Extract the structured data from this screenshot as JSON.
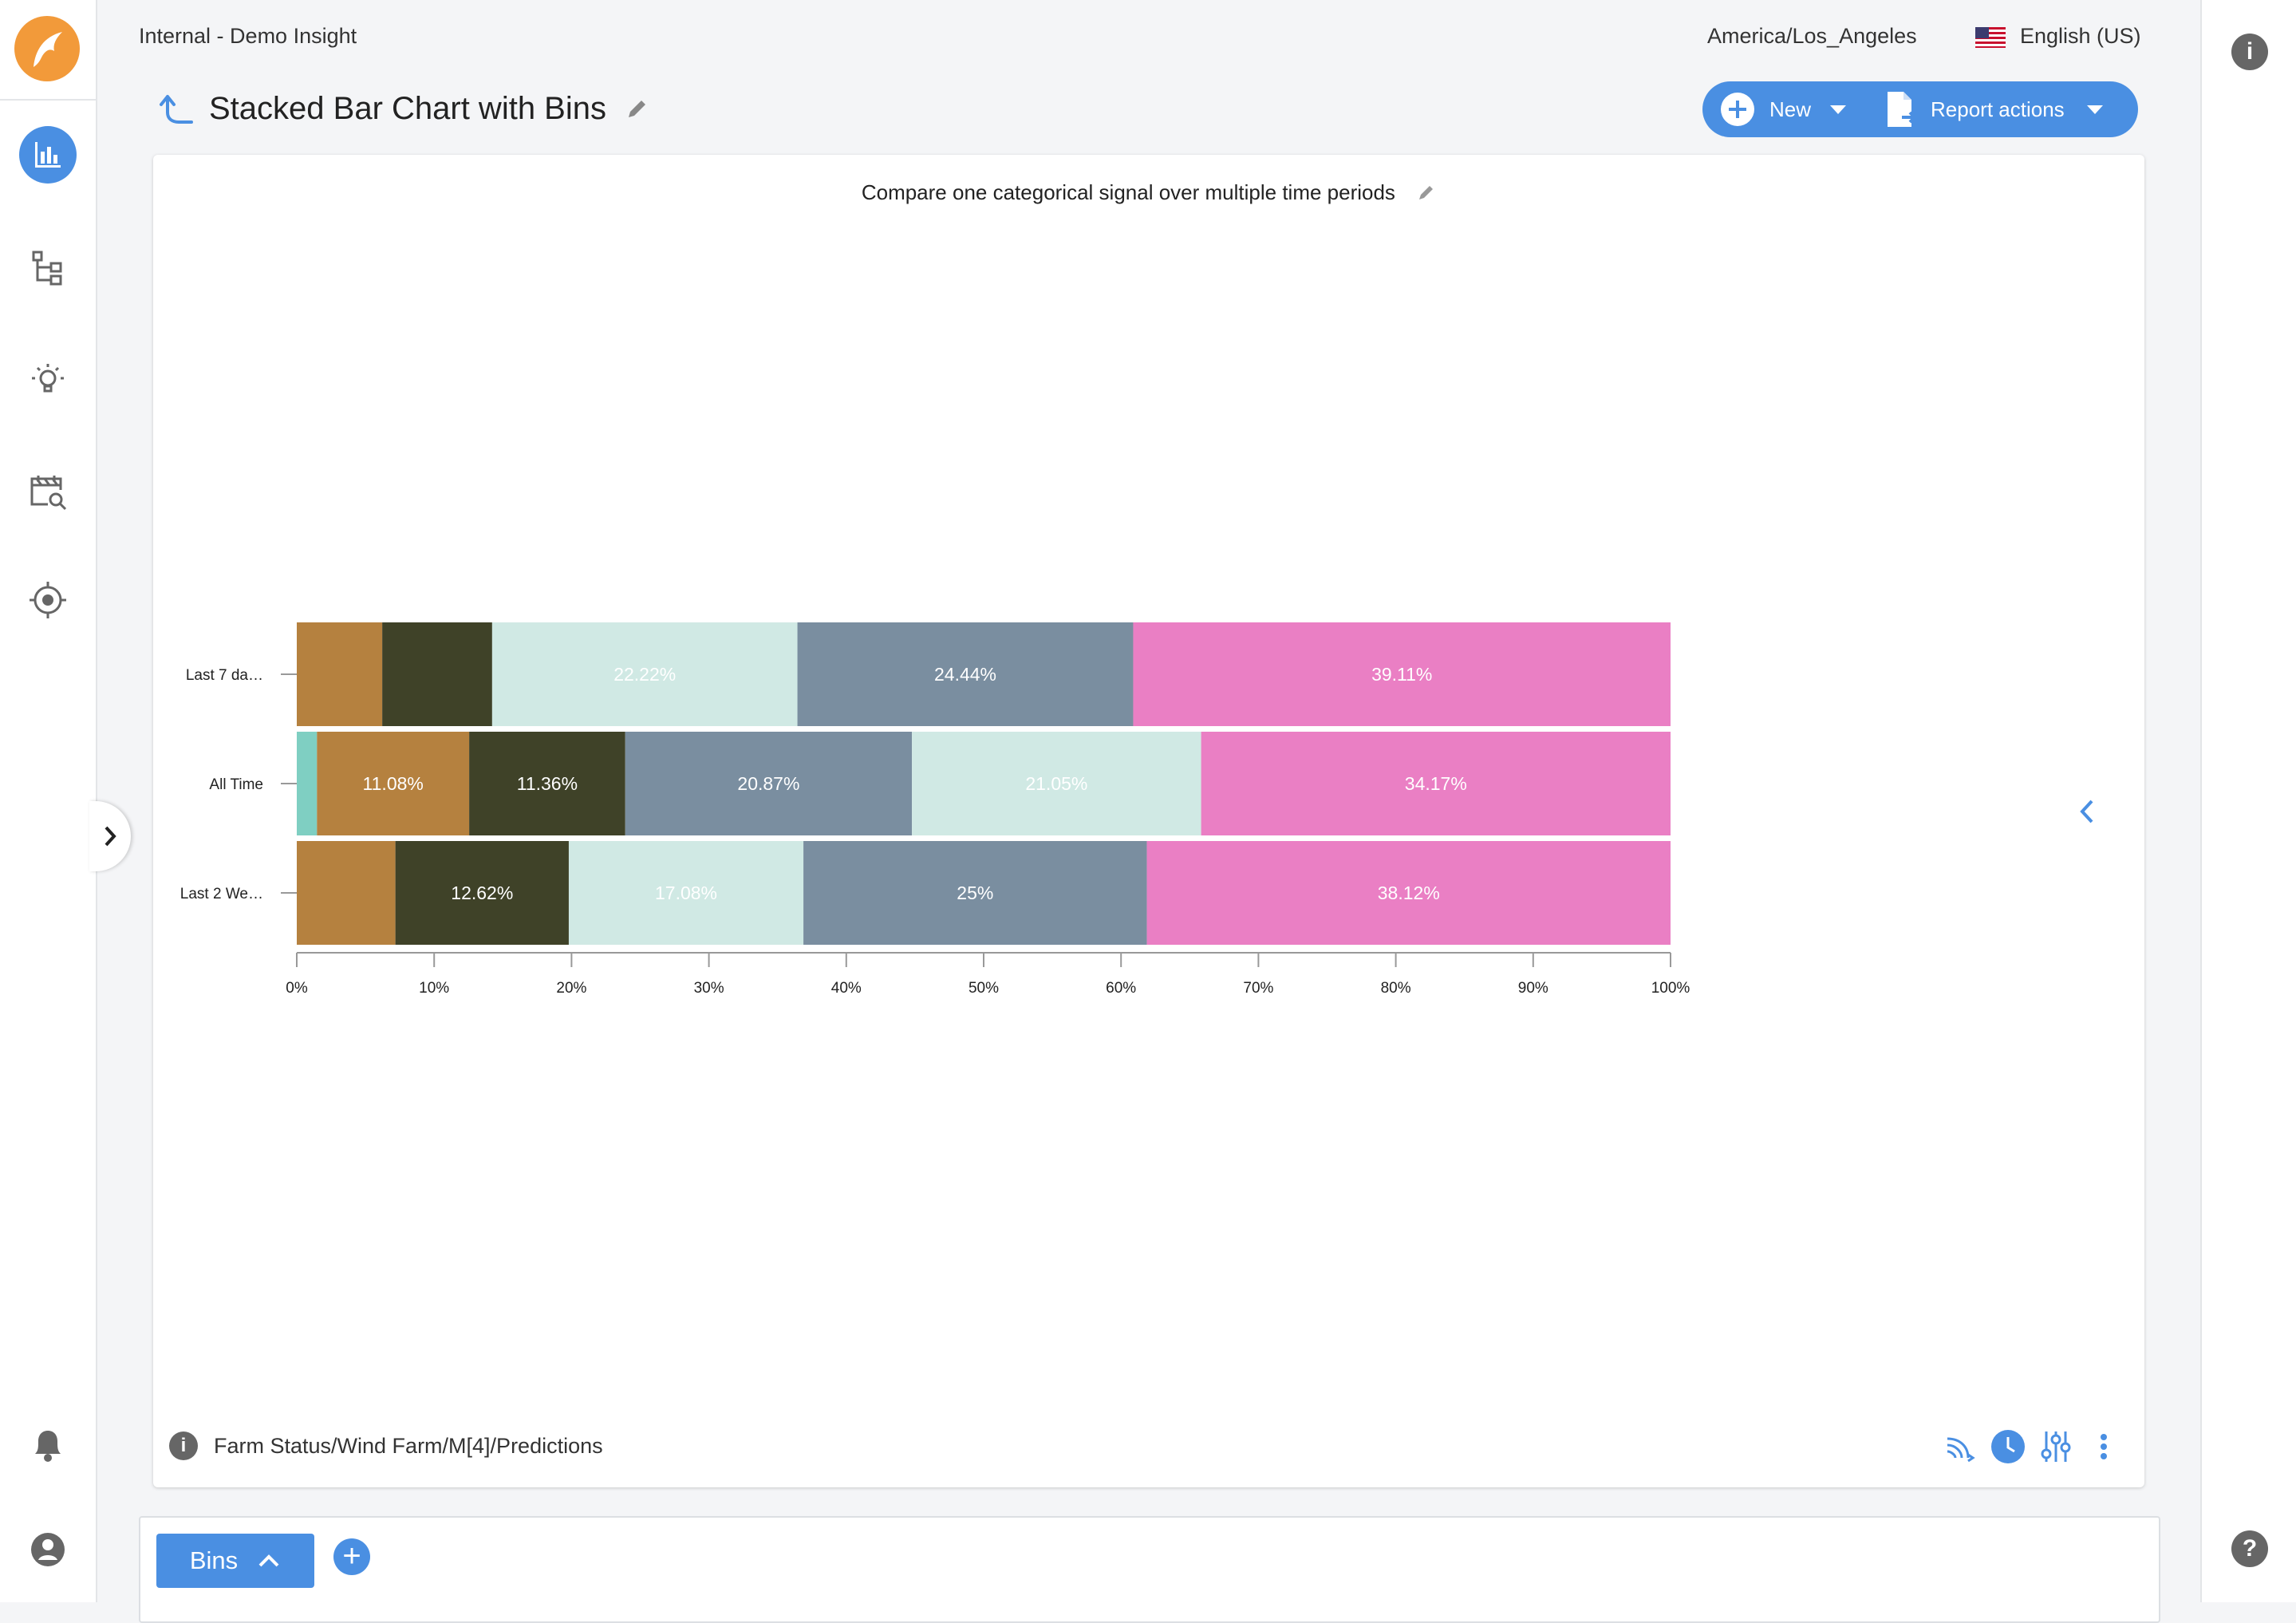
{
  "header": {
    "workspace": "Internal - Demo Insight",
    "timezone": "America/Los_Angeles",
    "language": "English (US)"
  },
  "page": {
    "title": "Stacked Bar Chart with Bins"
  },
  "actions": {
    "new_label": "New",
    "report_actions_label": "Report actions"
  },
  "sidebar": {
    "items": [
      {
        "name": "analysis",
        "icon": "bar-chart-icon",
        "active": true
      },
      {
        "name": "asset-tree",
        "icon": "tree-icon"
      },
      {
        "name": "insights",
        "icon": "lightbulb-icon"
      },
      {
        "name": "search-data",
        "icon": "calendar-search-icon"
      },
      {
        "name": "target",
        "icon": "target-icon"
      }
    ],
    "bottom": [
      {
        "name": "notifications",
        "icon": "bell-icon"
      },
      {
        "name": "account",
        "icon": "user-icon"
      }
    ]
  },
  "chart_card": {
    "title": "Compare one categorical signal over multiple time periods",
    "signal_path": "Farm Status/Wind Farm/M[4]/Predictions"
  },
  "chart_data": {
    "type": "bar",
    "orientation": "horizontal",
    "stacked": "percent",
    "categories": [
      "Last 7 da…",
      "All Time",
      "Last 2 We…"
    ],
    "xlim": [
      0,
      100
    ],
    "xticks": [
      "0%",
      "10%",
      "20%",
      "30%",
      "40%",
      "50%",
      "60%",
      "70%",
      "80%",
      "90%",
      "100%"
    ],
    "bars": [
      {
        "segments": [
          {
            "value": 6.22,
            "color": "#b5813f",
            "label": ""
          },
          {
            "value": 8.0,
            "color": "#3f4228",
            "label": ""
          },
          {
            "value": 22.22,
            "color": "#d0e9e4",
            "label": "22.22%"
          },
          {
            "value": 24.44,
            "color": "#7a8ea0",
            "label": "24.44%"
          },
          {
            "value": 39.11,
            "color": "#ea7fc4",
            "label": "39.11%"
          }
        ]
      },
      {
        "segments": [
          {
            "value": 1.47,
            "color": "#7fcfc2",
            "label": ""
          },
          {
            "value": 11.08,
            "color": "#b5813f",
            "label": "11.08%"
          },
          {
            "value": 11.36,
            "color": "#3f4228",
            "label": "11.36%"
          },
          {
            "value": 20.87,
            "color": "#7a8ea0",
            "label": "20.87%"
          },
          {
            "value": 21.05,
            "color": "#d0e9e4",
            "label": "21.05%"
          },
          {
            "value": 34.17,
            "color": "#ea7fc4",
            "label": "34.17%"
          }
        ]
      },
      {
        "segments": [
          {
            "value": 7.18,
            "color": "#b5813f",
            "label": ""
          },
          {
            "value": 12.62,
            "color": "#3f4228",
            "label": "12.62%"
          },
          {
            "value": 17.08,
            "color": "#d0e9e4",
            "label": "17.08%"
          },
          {
            "value": 25.0,
            "color": "#7a8ea0",
            "label": "25%"
          },
          {
            "value": 38.12,
            "color": "#ea7fc4",
            "label": "38.12%"
          }
        ]
      }
    ]
  },
  "bottom_panel": {
    "bins_label": "Bins",
    "add_label": "+"
  },
  "colors": {
    "accent": "#4a8fe2",
    "logo": "#f29a3a"
  }
}
